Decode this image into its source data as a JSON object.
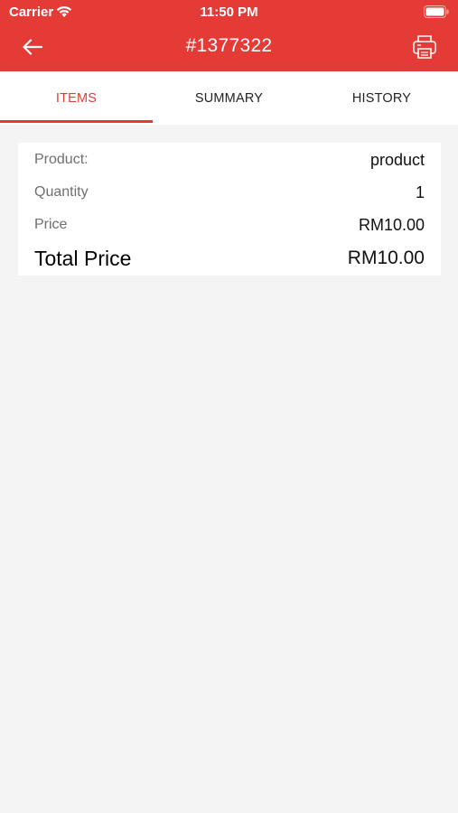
{
  "status_bar": {
    "carrier": "Carrier",
    "time": "11:50 PM",
    "icons": [
      "wifi-icon",
      "battery-icon"
    ]
  },
  "app_bar": {
    "title": "#1377322",
    "back_icon": "arrow-left-icon",
    "print_icon": "printer-icon",
    "color": "#e53b36"
  },
  "tabs": [
    {
      "label": "ITEMS",
      "active": true
    },
    {
      "label": "SUMMARY",
      "active": false
    },
    {
      "label": "HISTORY",
      "active": false
    }
  ],
  "item": {
    "product_label": "Product:",
    "product_value": "product",
    "quantity_label": "Quantity",
    "quantity_value": "1",
    "price_label": "Price",
    "price_value": "RM10.00",
    "total_label": "Total Price",
    "total_value": "RM10.00"
  }
}
